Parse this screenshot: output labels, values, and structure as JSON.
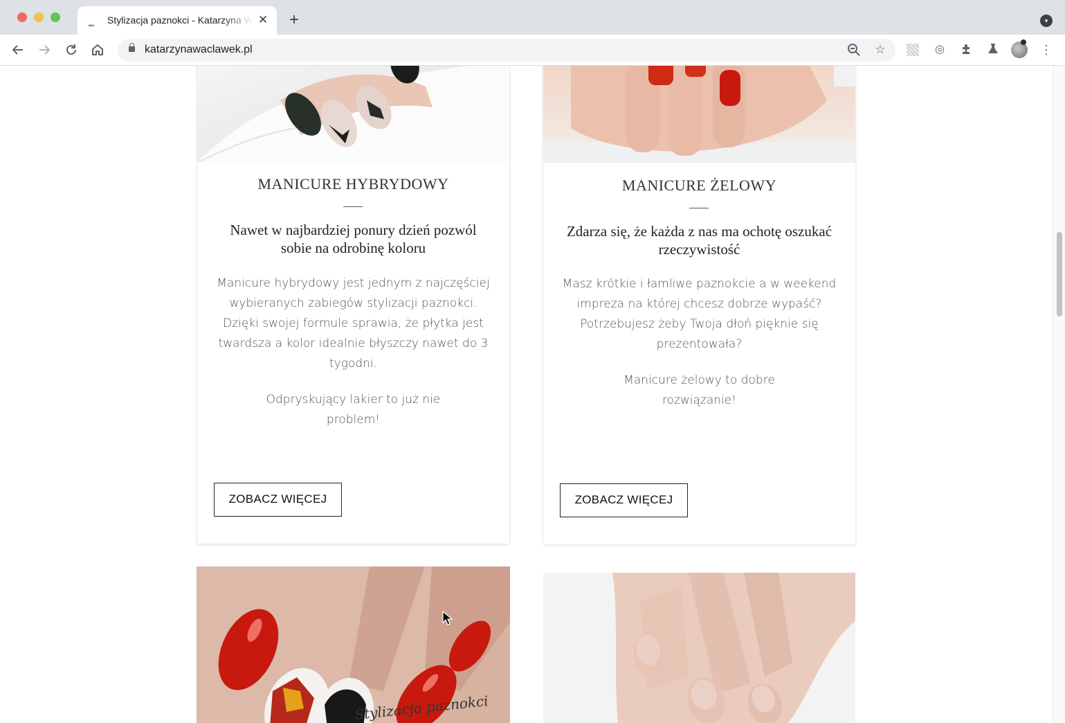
{
  "browser": {
    "tab_title": "Stylizacja paznokci - Katarzyna Wacławek",
    "tab_close": "✕",
    "new_tab": "+",
    "url": "katarzynawaclawek.pl",
    "icons": [
      "back-arrow-icon",
      "forward-arrow-icon",
      "reload-icon",
      "home-icon",
      "lock-icon",
      "zoom-out-icon",
      "bookmark-star-icon",
      "extensions-icon",
      "labs-flask-icon",
      "profile-avatar-icon",
      "menu-kebab-icon"
    ]
  },
  "cards": [
    {
      "title": "MANICURE HYBRYDOWY",
      "subtitle": "Nawet w najbardziej ponury dzień pozwól sobie na odrobinę koloru",
      "paragraph_1": "Manicure hybrydowy jest jednym z najczęściej wybieranych zabiegów stylizacji paznokci. Dzięki swojej formule sprawia, że płytka jest twardsza a kolor idealnie błyszczy nawet do 3 tygodni.",
      "paragraph_2": "Odpryskujący lakier to już nie problem!",
      "button": "ZOBACZ WIĘCEJ"
    },
    {
      "title": "MANICURE ŻELOWY",
      "subtitle": "Zdarza się, że każda z nas ma ochotę oszukać rzeczywistość",
      "paragraph_1": "Masz krótkie i łamliwe paznokcie a w weekend impreza na której chcesz dobrze wypaść? Potrzebujesz żeby Twoja dłoń pięknie się prezentowała?",
      "paragraph_2": "Manicure żelowy to dobre rozwiązanie!",
      "button": "ZOBACZ WIĘCEJ"
    }
  ],
  "photos": {
    "watermark": "Stylizacja paznokci"
  },
  "colors": {
    "nail_red": "#c8190f",
    "nail_black": "#1f1f1f",
    "nude": "#e7c2b0"
  }
}
